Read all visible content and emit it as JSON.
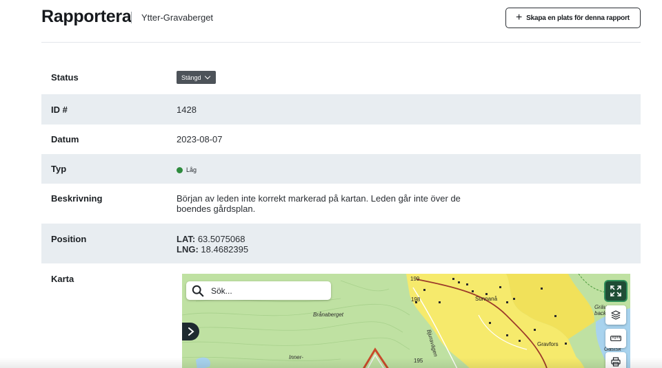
{
  "header": {
    "brand": "Rapportera",
    "site_name": "Ytter-Gravaberget",
    "create_button_label": "Skapa en plats för denna rapport",
    "create_button_icon": "plus-icon"
  },
  "fields": {
    "status": {
      "label": "Status",
      "value": "Stängd",
      "icon": "chevron-down-icon"
    },
    "id": {
      "label": "ID #",
      "value": "1428"
    },
    "date": {
      "label": "Datum",
      "value": "2023-08-07"
    },
    "type": {
      "label": "Typ",
      "value": "Låg",
      "dot_color": "#2e8b3e"
    },
    "description": {
      "label": "Beskrivning",
      "value": "Början av leden inte korrekt markerad på kartan. Leden går inte över de boendes gårdsplan."
    },
    "position": {
      "label": "Position",
      "lat_label": "LAT:",
      "lat_value": "63.5075068",
      "lng_label": "LNG:",
      "lng_value": "18.4682395"
    },
    "map": {
      "label": "Karta"
    }
  },
  "map": {
    "search_placeholder": "Sök...",
    "search_icon": "search-icon",
    "toggle_icon": "chevron-right-icon",
    "controls": [
      "fullscreen-icon",
      "layers-icon",
      "ruler-icon",
      "print-icon"
    ],
    "place_labels": {
      "branaberget": "Brånaberget",
      "sunnana": "Sunnanå",
      "gravfors": "Gravfors",
      "inner": "Inner-",
      "bjuravagen": "Bjuravägen",
      "graver": "Gräver",
      "backe": "backe",
      "gastsk": "Gästsk",
      "n199": "199",
      "n198": "198",
      "n195": "195"
    },
    "colors": {
      "forest": "#bfe1a2",
      "field": "#f6ea6c",
      "water": "#a8d3ee",
      "road": "#9c3a2a"
    }
  }
}
